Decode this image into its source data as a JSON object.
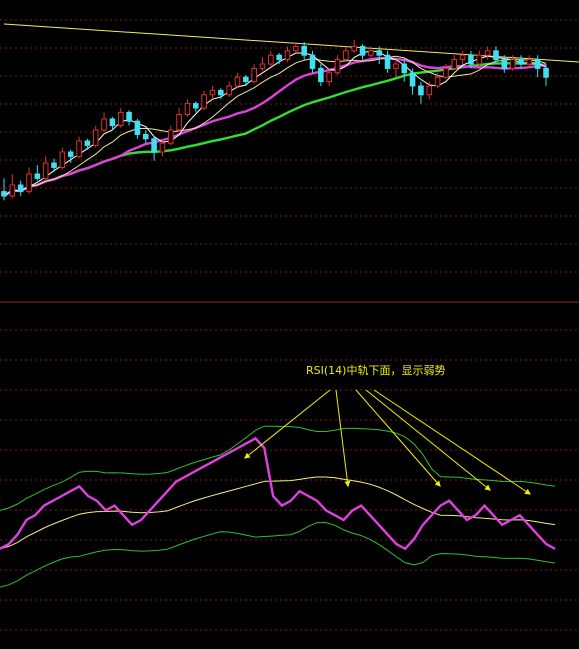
{
  "colors": {
    "background": "#000000",
    "grid": "#7a1c1c",
    "divider": "#7a1c1c",
    "up_candle": "#e03030",
    "down_candle": "#40e0f0",
    "ma_short": "#ffffff",
    "ma_mid": "#e8e8a0",
    "ma_pink": "#e040e0",
    "ma_green": "#30e030",
    "trendline": "#f0f060",
    "rsi_line": "#e040e0",
    "rsi_mid": "#f0f080",
    "band": "#30c030",
    "annotation": "#f0f000"
  },
  "annotation": {
    "text": "RSI(14)中轨下面，显示弱势"
  },
  "chart_data": [
    {
      "type": "candlestick",
      "title": "",
      "grid": true,
      "ylim": [
        0,
        100
      ],
      "candles": [
        [
          22,
          20,
          28,
          18
        ],
        [
          20,
          25,
          30,
          19
        ],
        [
          25,
          22,
          27,
          20
        ],
        [
          22,
          30,
          33,
          21
        ],
        [
          30,
          28,
          34,
          27
        ],
        [
          28,
          35,
          38,
          27
        ],
        [
          35,
          33,
          37,
          31
        ],
        [
          33,
          40,
          42,
          32
        ],
        [
          40,
          38,
          41,
          35
        ],
        [
          38,
          45,
          47,
          37
        ],
        [
          45,
          43,
          46,
          41
        ],
        [
          43,
          50,
          52,
          42
        ],
        [
          50,
          55,
          58,
          49
        ],
        [
          55,
          52,
          56,
          50
        ],
        [
          52,
          58,
          60,
          51
        ],
        [
          58,
          54,
          59,
          52
        ],
        [
          54,
          48,
          55,
          46
        ],
        [
          48,
          46,
          50,
          44
        ],
        [
          46,
          40,
          47,
          36
        ],
        [
          40,
          44,
          46,
          38
        ],
        [
          44,
          50,
          52,
          43
        ],
        [
          50,
          57,
          60,
          49
        ],
        [
          57,
          62,
          64,
          56
        ],
        [
          62,
          60,
          63,
          58
        ],
        [
          60,
          66,
          68,
          59
        ],
        [
          66,
          68,
          70,
          64
        ],
        [
          68,
          66,
          69,
          64
        ],
        [
          66,
          70,
          72,
          65
        ],
        [
          70,
          74,
          76,
          69
        ],
        [
          74,
          72,
          75,
          70
        ],
        [
          72,
          78,
          80,
          71
        ],
        [
          78,
          80,
          83,
          77
        ],
        [
          80,
          84,
          86,
          79
        ],
        [
          84,
          82,
          85,
          80
        ],
        [
          82,
          86,
          88,
          81
        ],
        [
          86,
          88,
          90,
          85
        ],
        [
          88,
          84,
          90,
          82
        ],
        [
          84,
          78,
          86,
          76
        ],
        [
          78,
          72,
          80,
          70
        ],
        [
          72,
          76,
          78,
          70
        ],
        [
          76,
          82,
          84,
          75
        ],
        [
          82,
          86,
          88,
          81
        ],
        [
          86,
          88,
          91,
          85
        ],
        [
          88,
          84,
          89,
          82
        ],
        [
          84,
          86,
          88,
          83
        ],
        [
          86,
          84,
          88,
          80
        ],
        [
          84,
          78,
          86,
          76
        ],
        [
          78,
          80,
          82,
          74
        ],
        [
          80,
          76,
          82,
          72
        ],
        [
          76,
          70,
          78,
          66
        ],
        [
          70,
          66,
          72,
          62
        ],
        [
          66,
          70,
          72,
          64
        ],
        [
          70,
          74,
          76,
          69
        ],
        [
          74,
          78,
          80,
          73
        ],
        [
          78,
          82,
          84,
          77
        ],
        [
          82,
          84,
          86,
          80
        ],
        [
          84,
          80,
          86,
          78
        ],
        [
          80,
          84,
          86,
          79
        ],
        [
          84,
          86,
          88,
          82
        ],
        [
          86,
          82,
          88,
          80
        ],
        [
          82,
          78,
          84,
          76
        ],
        [
          78,
          82,
          84,
          77
        ],
        [
          82,
          80,
          84,
          78
        ],
        [
          80,
          82,
          84,
          79
        ],
        [
          82,
          78,
          84,
          74
        ],
        [
          78,
          74,
          80,
          70
        ]
      ]
    },
    {
      "type": "line",
      "title": "RSI(14)",
      "grid": true,
      "ylim": [
        0,
        100
      ],
      "series": [
        {
          "values": [
            38,
            40,
            44,
            50,
            52,
            56,
            58,
            60,
            62,
            64,
            60,
            58,
            54,
            56,
            52,
            48,
            50,
            54,
            58,
            62,
            66,
            68,
            70,
            72,
            74,
            76,
            78,
            80,
            82,
            84,
            80,
            60,
            56,
            58,
            62,
            60,
            58,
            54,
            52,
            50,
            54,
            56,
            52,
            48,
            44,
            40,
            38,
            42,
            48,
            52,
            56,
            58,
            54,
            50,
            52,
            56,
            52,
            48,
            50,
            52,
            48,
            44,
            40,
            38
          ]
        }
      ]
    }
  ]
}
